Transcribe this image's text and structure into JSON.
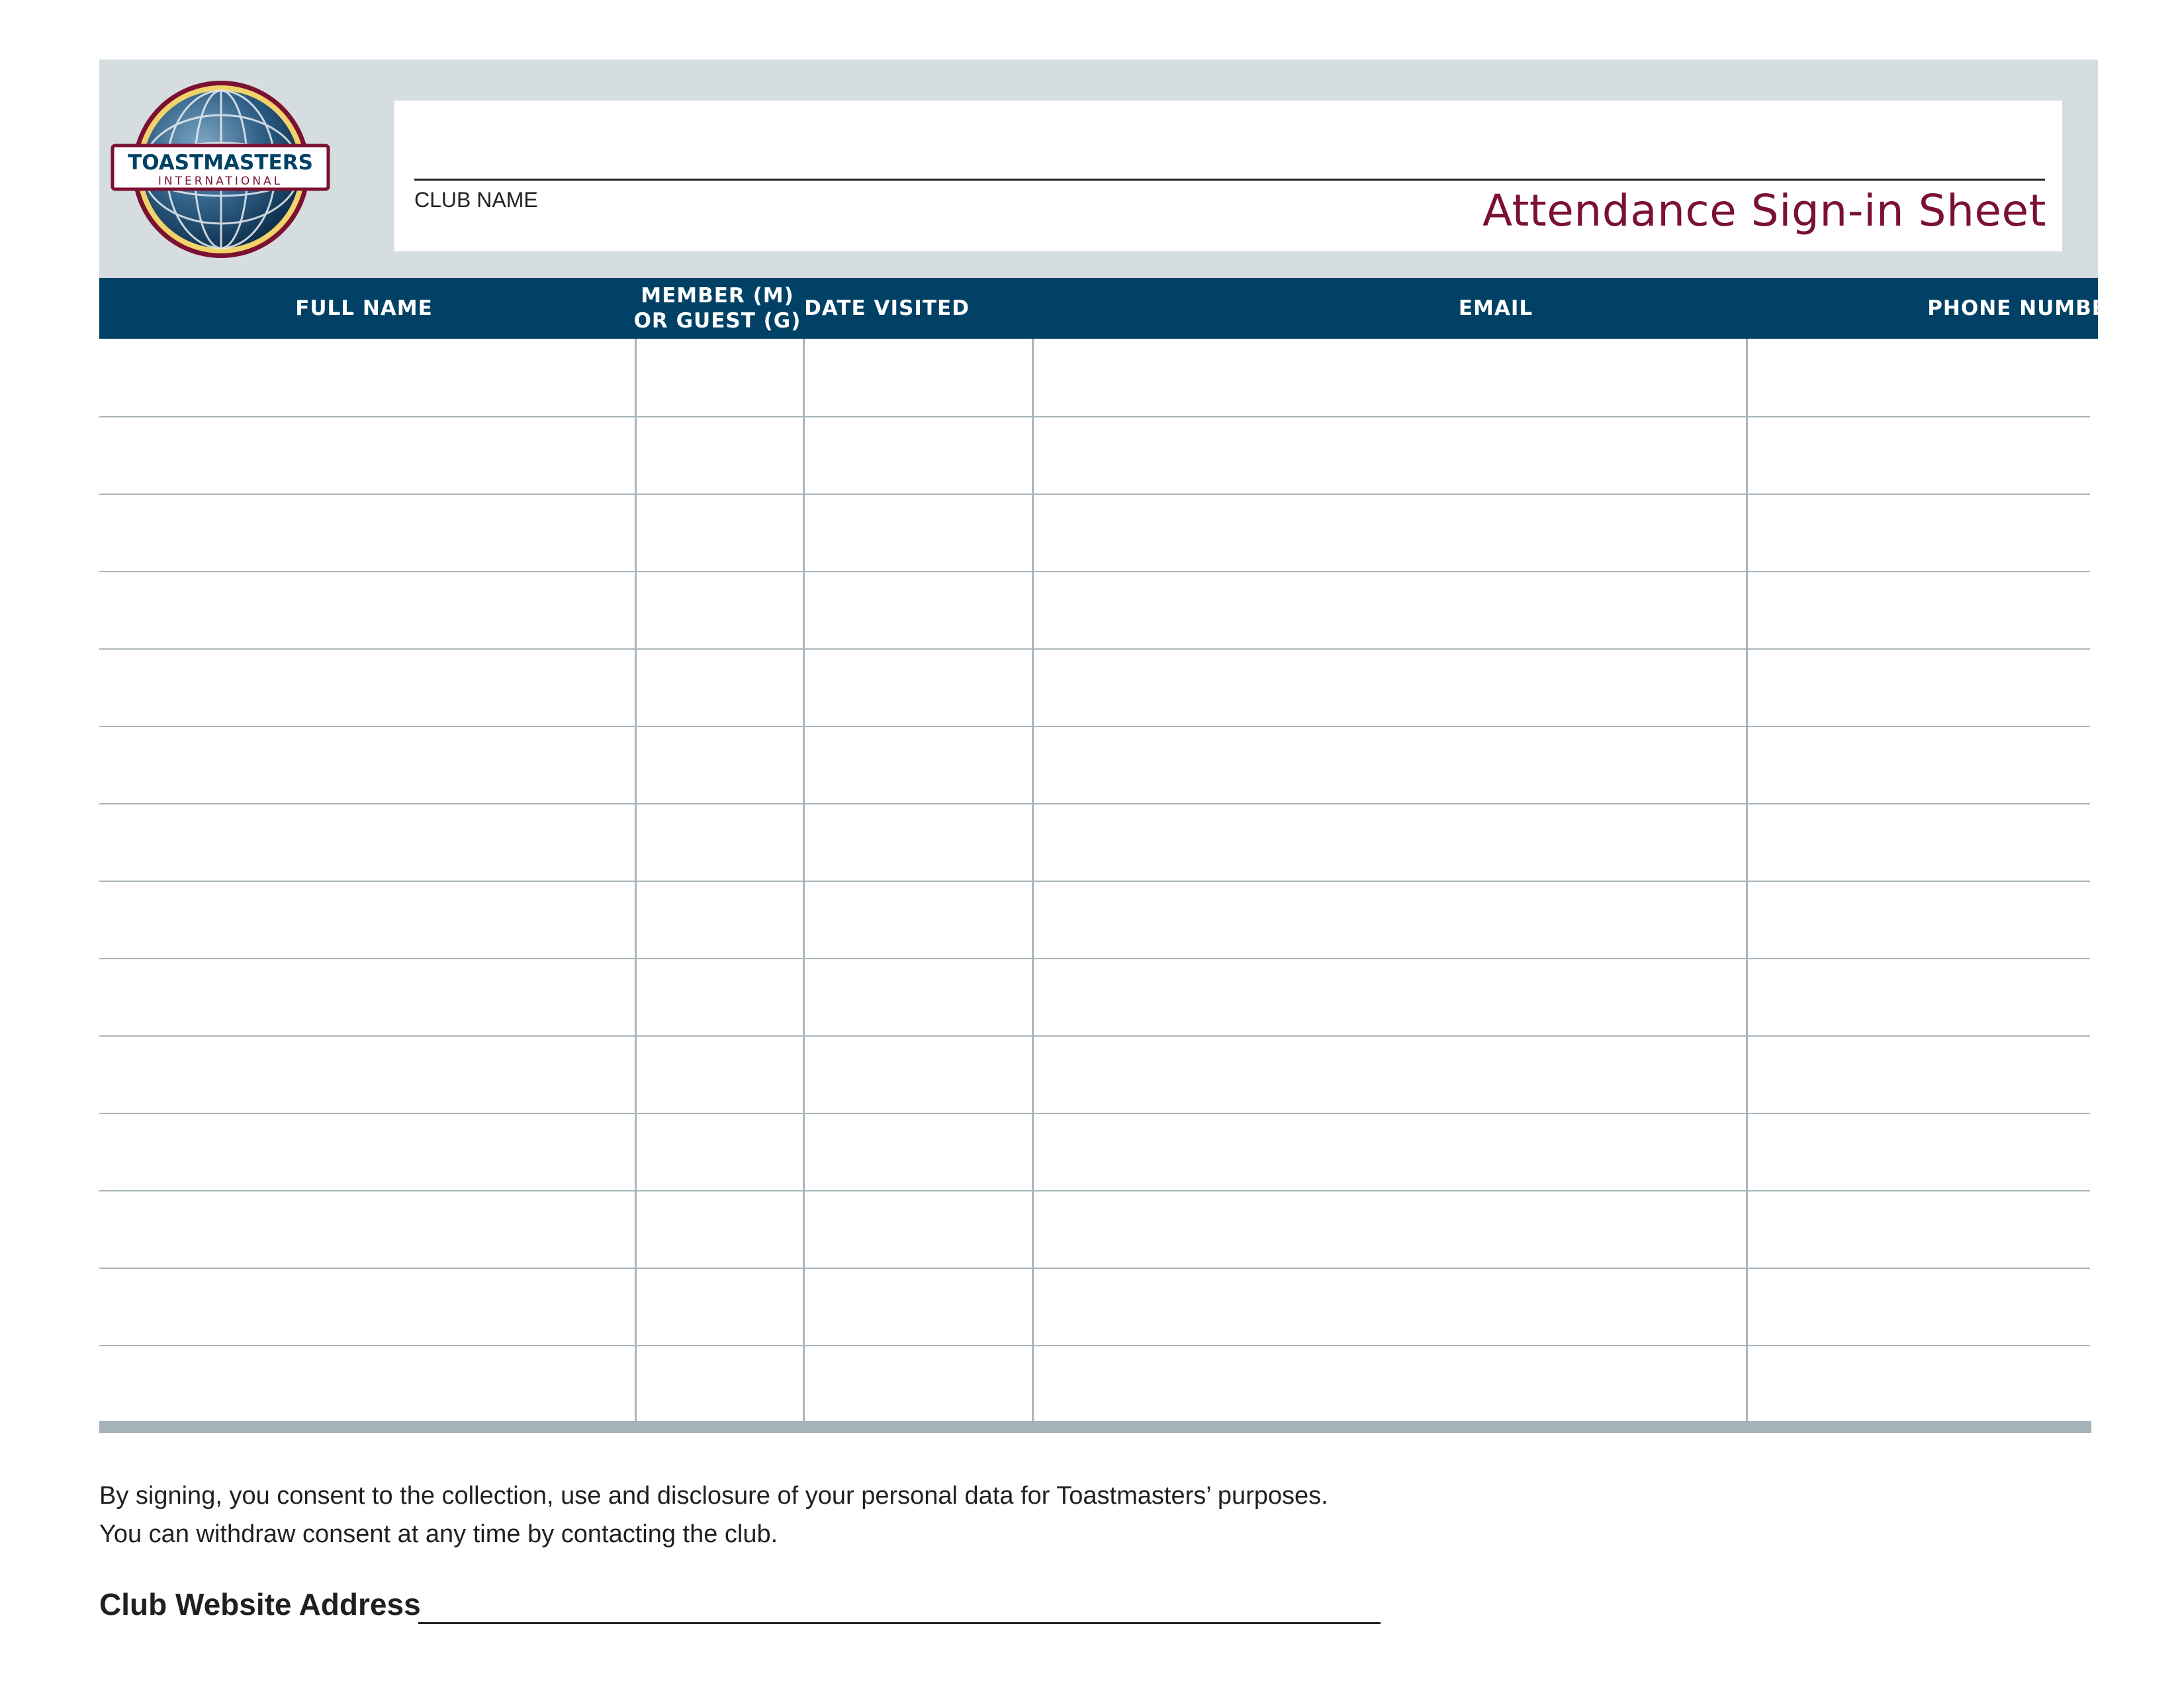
{
  "header": {
    "logo_text_top": "TOASTMASTERS",
    "logo_text_bottom": "INTERNATIONAL",
    "club_name_label": "CLUB NAME",
    "title": "Attendance Sign-in Sheet"
  },
  "colors": {
    "brand_blue": "#004165",
    "title_maroon": "#7b1131",
    "band_gray": "#d6dde0",
    "rule_gray": "#a9b6bc"
  },
  "table": {
    "columns": [
      {
        "label": "FULL NAME"
      },
      {
        "label_line1": "MEMBER (M)",
        "label_line2": "OR GUEST (G)"
      },
      {
        "label": "DATE VISITED"
      },
      {
        "label": "EMAIL"
      },
      {
        "label": "PHONE NUMBER"
      }
    ],
    "row_count": 14
  },
  "consent": {
    "line1": "By signing, you consent to the collection, use and disclosure of your personal data for Toastmasters’ purposes.",
    "line2": "You can withdraw consent at any time by contacting the club."
  },
  "website": {
    "label": "Club Website Address"
  }
}
